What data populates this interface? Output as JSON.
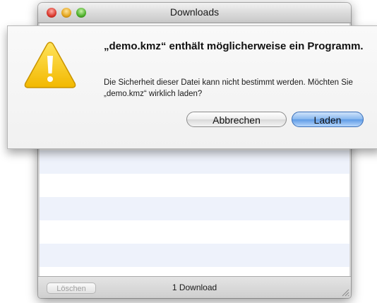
{
  "window": {
    "title": "Downloads",
    "status_text": "1 Download",
    "clear_button_label": "Löschen"
  },
  "dialog": {
    "headline": "„demo.kmz“ enthält möglicherweise ein Programm.",
    "message": "Die Sicherheit dieser Datei kann nicht bestimmt werden. Möchten Sie „demo.kmz“ wirklich laden?",
    "cancel_label": "Abbrechen",
    "confirm_label": "Laden",
    "icon": "warning-icon"
  },
  "colors": {
    "warning_yellow": "#f7c600",
    "default_button_blue": "#6aa6ea",
    "list_stripe": "#eef2fb"
  }
}
